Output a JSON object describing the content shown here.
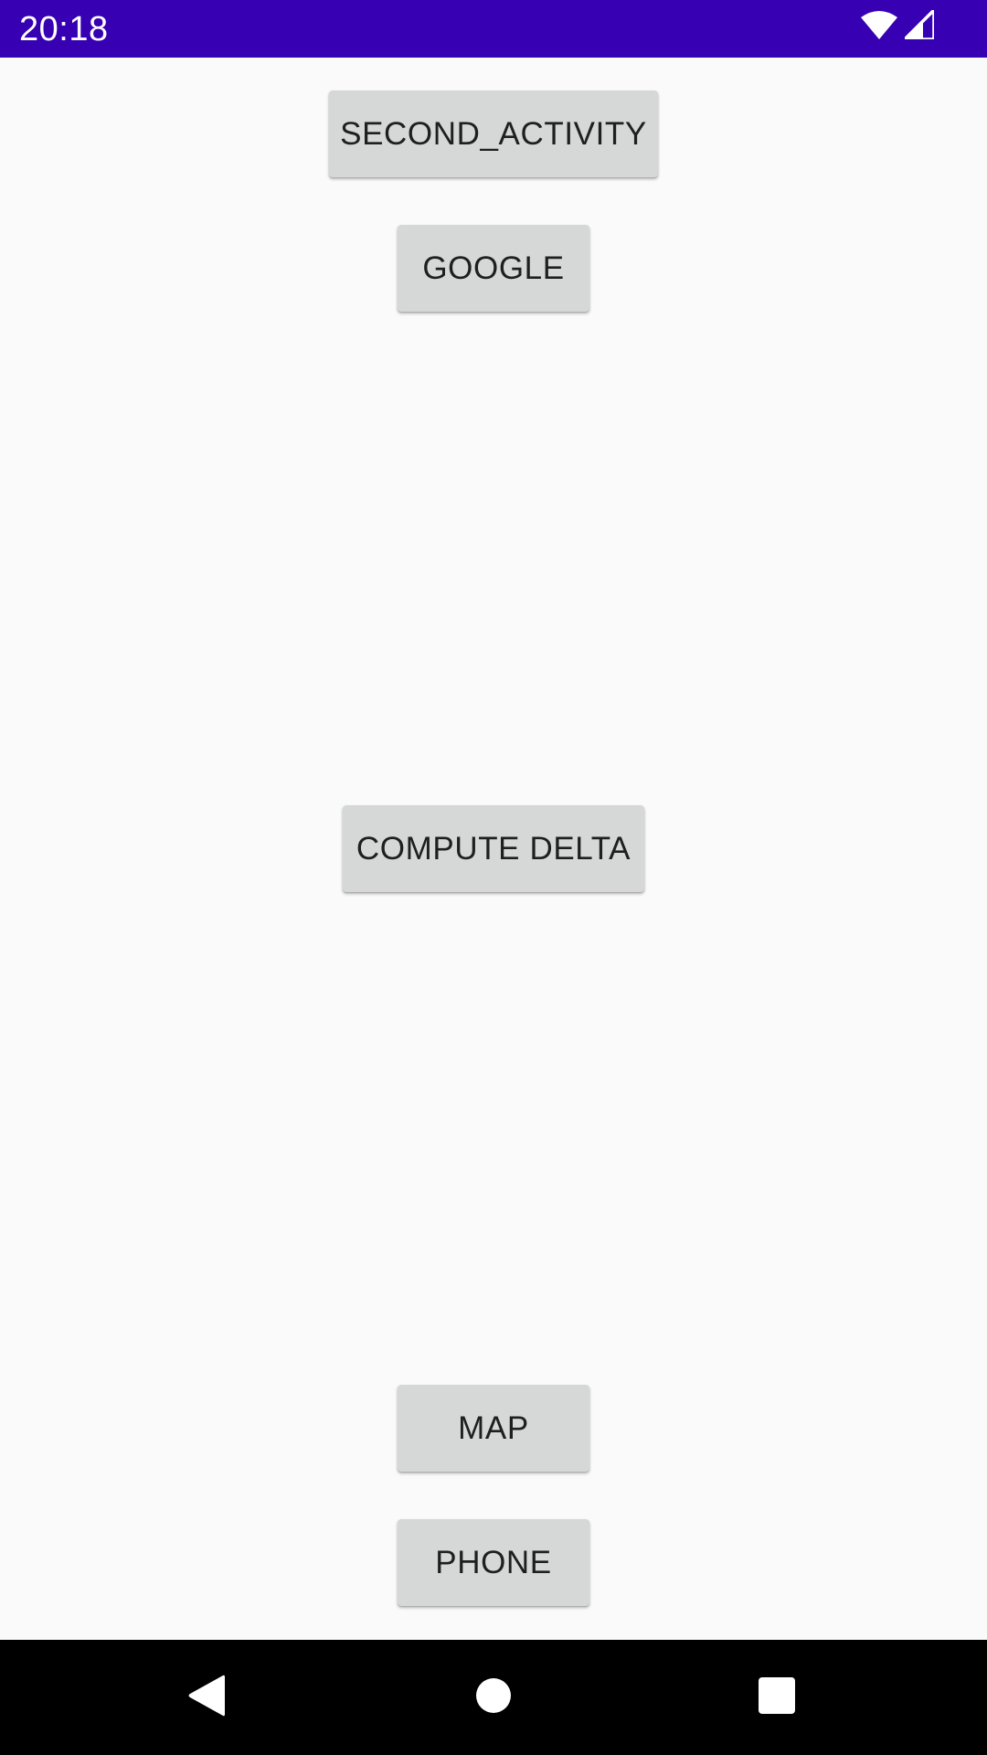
{
  "status_bar": {
    "time": "20:18",
    "icons": [
      "wifi-icon",
      "cell-signal-icon"
    ],
    "background_color": "#3700b3"
  },
  "buttons": {
    "second_activity": "SECOND_ACTIVITY",
    "google": "GOOGLE",
    "compute_delta": "COMPUTE DELTA",
    "map": "MAP",
    "phone": "PHONE"
  },
  "nav_bar": {
    "icons": [
      "back-icon",
      "home-icon",
      "recents-icon"
    ]
  }
}
